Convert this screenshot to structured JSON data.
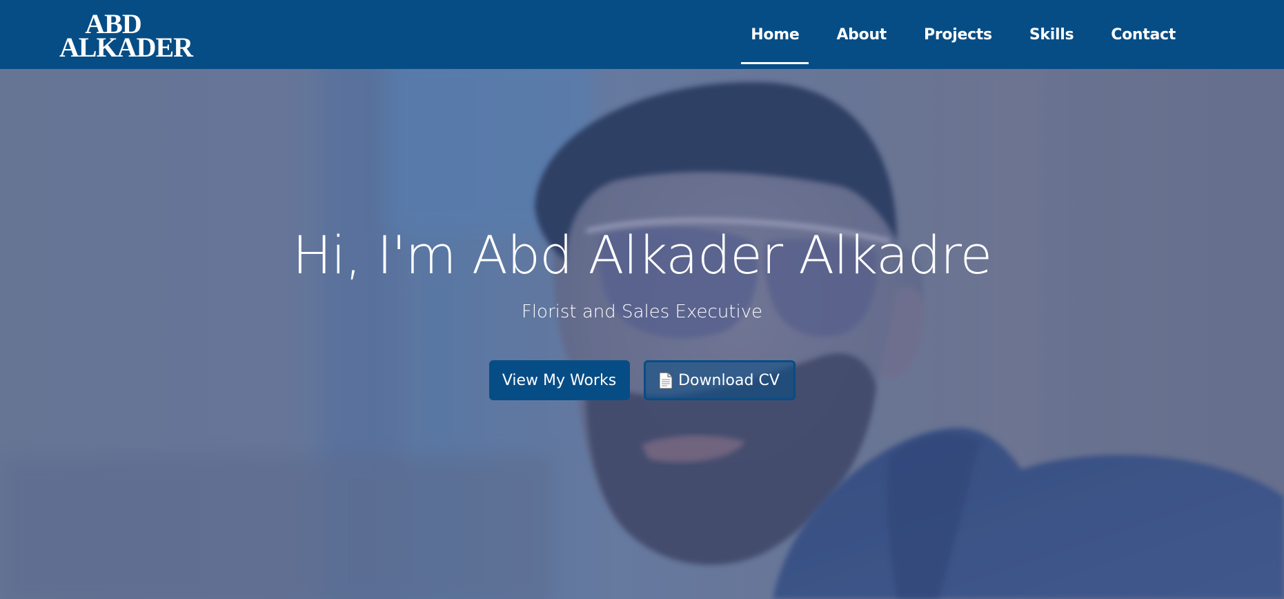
{
  "brand": {
    "line1": "ABD",
    "line2": "ALKADER"
  },
  "nav": {
    "items": [
      {
        "label": "Home",
        "active": true
      },
      {
        "label": "About",
        "active": false
      },
      {
        "label": "Projects",
        "active": false
      },
      {
        "label": "Skills",
        "active": false
      },
      {
        "label": "Contact",
        "active": false
      }
    ]
  },
  "hero": {
    "title": "Hi, I'm Abd Alkader Alkadre",
    "subtitle": "Florist and Sales Executive",
    "primary_button": "View My Works",
    "secondary_button": "Download CV",
    "secondary_button_icon": "document-icon"
  },
  "colors": {
    "primary": "#074d85",
    "text_on_primary": "#ffffff"
  }
}
